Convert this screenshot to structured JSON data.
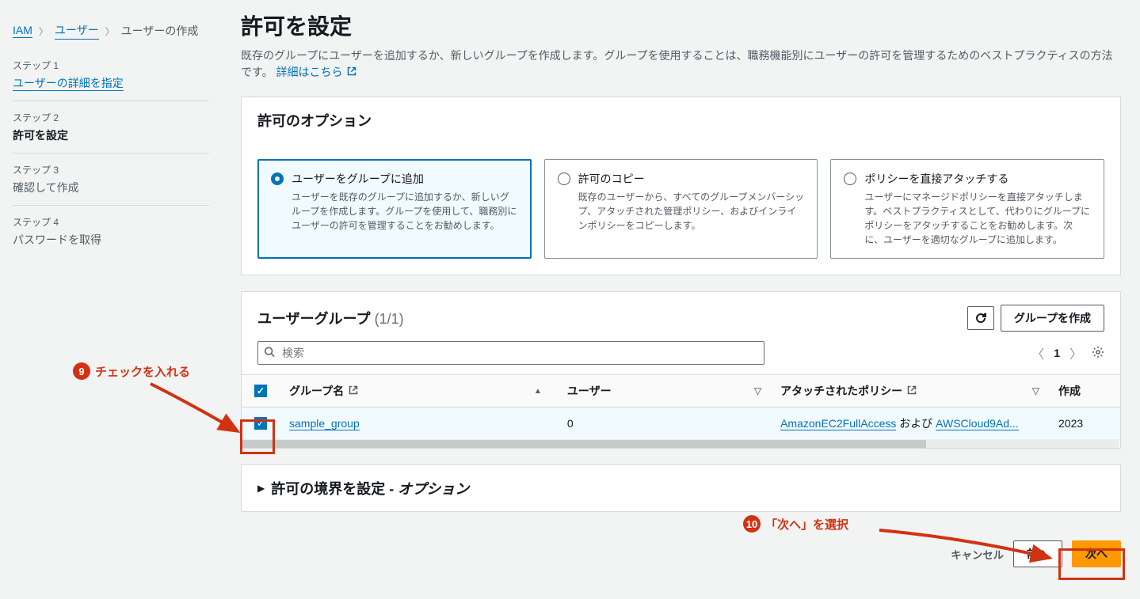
{
  "breadcrumb": {
    "root": "IAM",
    "users": "ユーザー",
    "current": "ユーザーの作成"
  },
  "steps": [
    {
      "num": "ステップ 1",
      "title": "ユーザーの詳細を指定"
    },
    {
      "num": "ステップ 2",
      "title": "許可を設定"
    },
    {
      "num": "ステップ 3",
      "title": "確認して作成"
    },
    {
      "num": "ステップ 4",
      "title": "パスワードを取得"
    }
  ],
  "heading": "許可を設定",
  "subtitle": "既存のグループにユーザーを追加するか、新しいグループを作成します。グループを使用することは、職務機能別にユーザーの許可を管理するためのベストプラクティスの方法です。 ",
  "learn_more": "詳細はこちら",
  "perm_options": {
    "title": "許可のオプション",
    "items": [
      {
        "title": "ユーザーをグループに追加",
        "desc": "ユーザーを既存のグループに追加するか、新しいグループを作成します。グループを使用して、職務別にユーザーの許可を管理することをお勧めします。"
      },
      {
        "title": "許可のコピー",
        "desc": "既存のユーザーから、すべてのグループメンバーシップ、アタッチされた管理ポリシー、およびインラインポリシーをコピーします。"
      },
      {
        "title": "ポリシーを直接アタッチする",
        "desc": "ユーザーにマネージドポリシーを直接アタッチします。ベストプラクティスとして、代わりにグループにポリシーをアタッチすることをお勧めします。次に、ユーザーを適切なグループに追加します。"
      }
    ]
  },
  "groups": {
    "title": "ユーザーグループ",
    "count": "(1/1)",
    "create_btn": "グループを作成",
    "search_placeholder": "検索",
    "page": "1",
    "columns": {
      "name": "グループ名",
      "users": "ユーザー",
      "policies": "アタッチされたポリシー",
      "created": "作成"
    },
    "rows": [
      {
        "name": "sample_group",
        "users": "0",
        "policy1": "AmazonEC2FullAccess",
        "and": " および ",
        "policy2": "AWSCloud9Ad...",
        "created": "2023"
      }
    ]
  },
  "boundary": {
    "title": "許可の境界を設定 - ",
    "option": "オプション"
  },
  "footer": {
    "cancel": "キャンセル",
    "prev": "前へ",
    "next": "次へ"
  },
  "annotations": {
    "a9_num": "9",
    "a9_text": "チェックを入れる",
    "a10_num": "10",
    "a10_text": "「次へ」を選択"
  }
}
